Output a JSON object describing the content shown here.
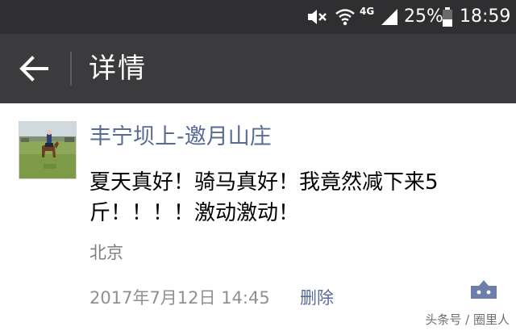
{
  "status_bar": {
    "network": "4G",
    "battery": "25%",
    "time": "18:59",
    "icons": [
      "mute-icon",
      "wifi-icon",
      "signal-icon",
      "battery-icon"
    ]
  },
  "header": {
    "title": "详情",
    "back_icon": "back-arrow-icon"
  },
  "post": {
    "author": "丰宁坝上-邀月山庄",
    "text": "夏天真好！骑马真好！我竟然减下来5斤！！！！激动激动！",
    "location": "北京",
    "timestamp": "2017年7月12日 14:45",
    "delete_label": "删除",
    "comment_icon": "comment-icon"
  },
  "watermark": "头条号 / 圈里人",
  "colors": {
    "status_bar_bg": "#2f2f31",
    "app_bar_bg": "#3b3b3d",
    "link": "#576b95",
    "meta": "#8f8f8f"
  }
}
